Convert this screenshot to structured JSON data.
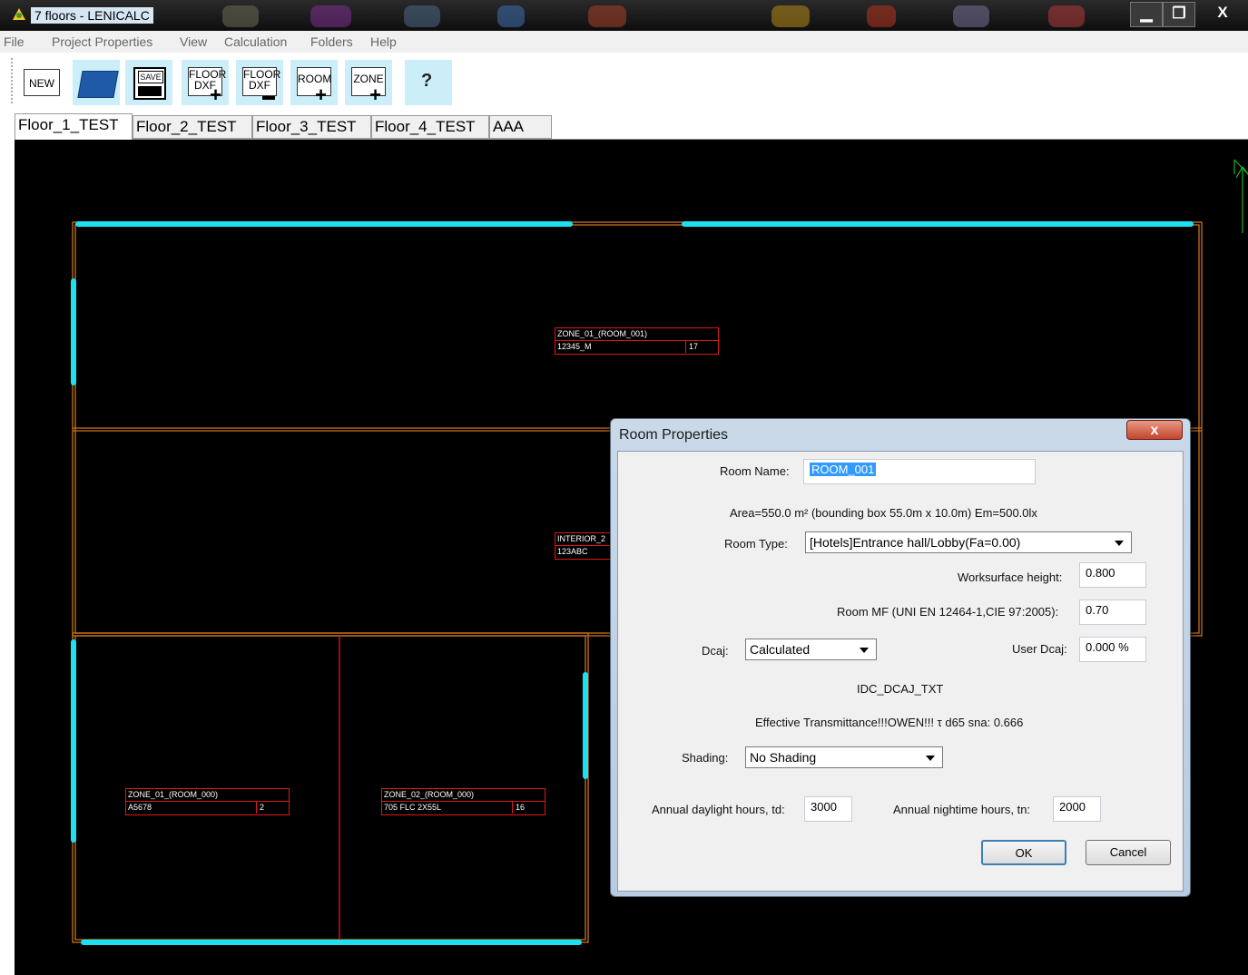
{
  "window": {
    "title": "7 floors - LENICALC",
    "minimize_glyph": "▁",
    "maximize_glyph": "❐",
    "close_glyph": "X"
  },
  "menu": [
    "File",
    "Project Properties",
    "View",
    "Calculation",
    "Folders",
    "Help"
  ],
  "toolbar": {
    "new_label": "NEW",
    "save_label": "SAVE",
    "floor_label": "FLOOR",
    "dxf_label": "DXF",
    "room_label": "ROOM",
    "zone_label": "ZONE",
    "plus_glyph": "+",
    "help_glyph": "?",
    "icons": [
      "new-file-icon",
      "open-folder-icon",
      "save-disk-icon",
      "floor-dxf-add-icon",
      "floor-dxf-remove-icon",
      "room-add-icon",
      "zone-add-icon",
      "help-icon"
    ]
  },
  "tabs": [
    "Floor_1_TEST",
    "Floor_2_TEST",
    "Floor_3_TEST",
    "Floor_4_TEST",
    "AAA"
  ],
  "active_tab": "Floor_1_TEST",
  "plan": {
    "labels": [
      {
        "name": "ZONE_01_(ROOM_001)",
        "code": "12345_M",
        "count": "17"
      },
      {
        "name": "INTERIOR_2",
        "code": "123ABC",
        "count": ""
      },
      {
        "name": "ZONE_01_(ROOM_000)",
        "code": "A5678",
        "count": "2"
      },
      {
        "name": "ZONE_02_(ROOM_000)",
        "code": "705 FLC 2X55L",
        "count": "16"
      }
    ],
    "colors": {
      "background": "#000000",
      "wall": "#c8731e",
      "window": "#1ee0f0",
      "label": "#e01818",
      "partition": "#d01010",
      "north_arrow": "#1fb31f"
    }
  },
  "dialog": {
    "title": "Room Properties",
    "close_glyph": "x",
    "room_name_label": "Room Name:",
    "room_name_value": "ROOM_001",
    "area_text": "Area=550.0 m²  (bounding box 55.0m x 10.0m) Em=500.0lx",
    "room_type_label": "Room Type:",
    "room_type_value": "[Hotels]Entrance hall/Lobby(Fa=0.00)",
    "worksurface_label": "Worksurface height:",
    "worksurface_value": "0.800",
    "mf_label": "Room MF (UNI EN 12464-1,CIE 97:2005):",
    "mf_value": "0.70",
    "dcaj_label": "Dcaj:",
    "dcaj_value": "Calculated",
    "user_dcaj_label": "User Dcaj:",
    "user_dcaj_value": "0.000 %",
    "idc_text": "IDC_DCAJ_TXT",
    "transmittance_text": "Effective Transmittance!!!OWEN!!! τ d65 sna: 0.666",
    "shading_label": "Shading:",
    "shading_value": "No Shading",
    "day_hours_label": "Annual daylight hours, td:",
    "day_hours_value": "3000",
    "night_hours_label": "Annual nightime hours, tn:",
    "night_hours_value": "2000",
    "ok_label": "OK",
    "cancel_label": "Cancel"
  }
}
